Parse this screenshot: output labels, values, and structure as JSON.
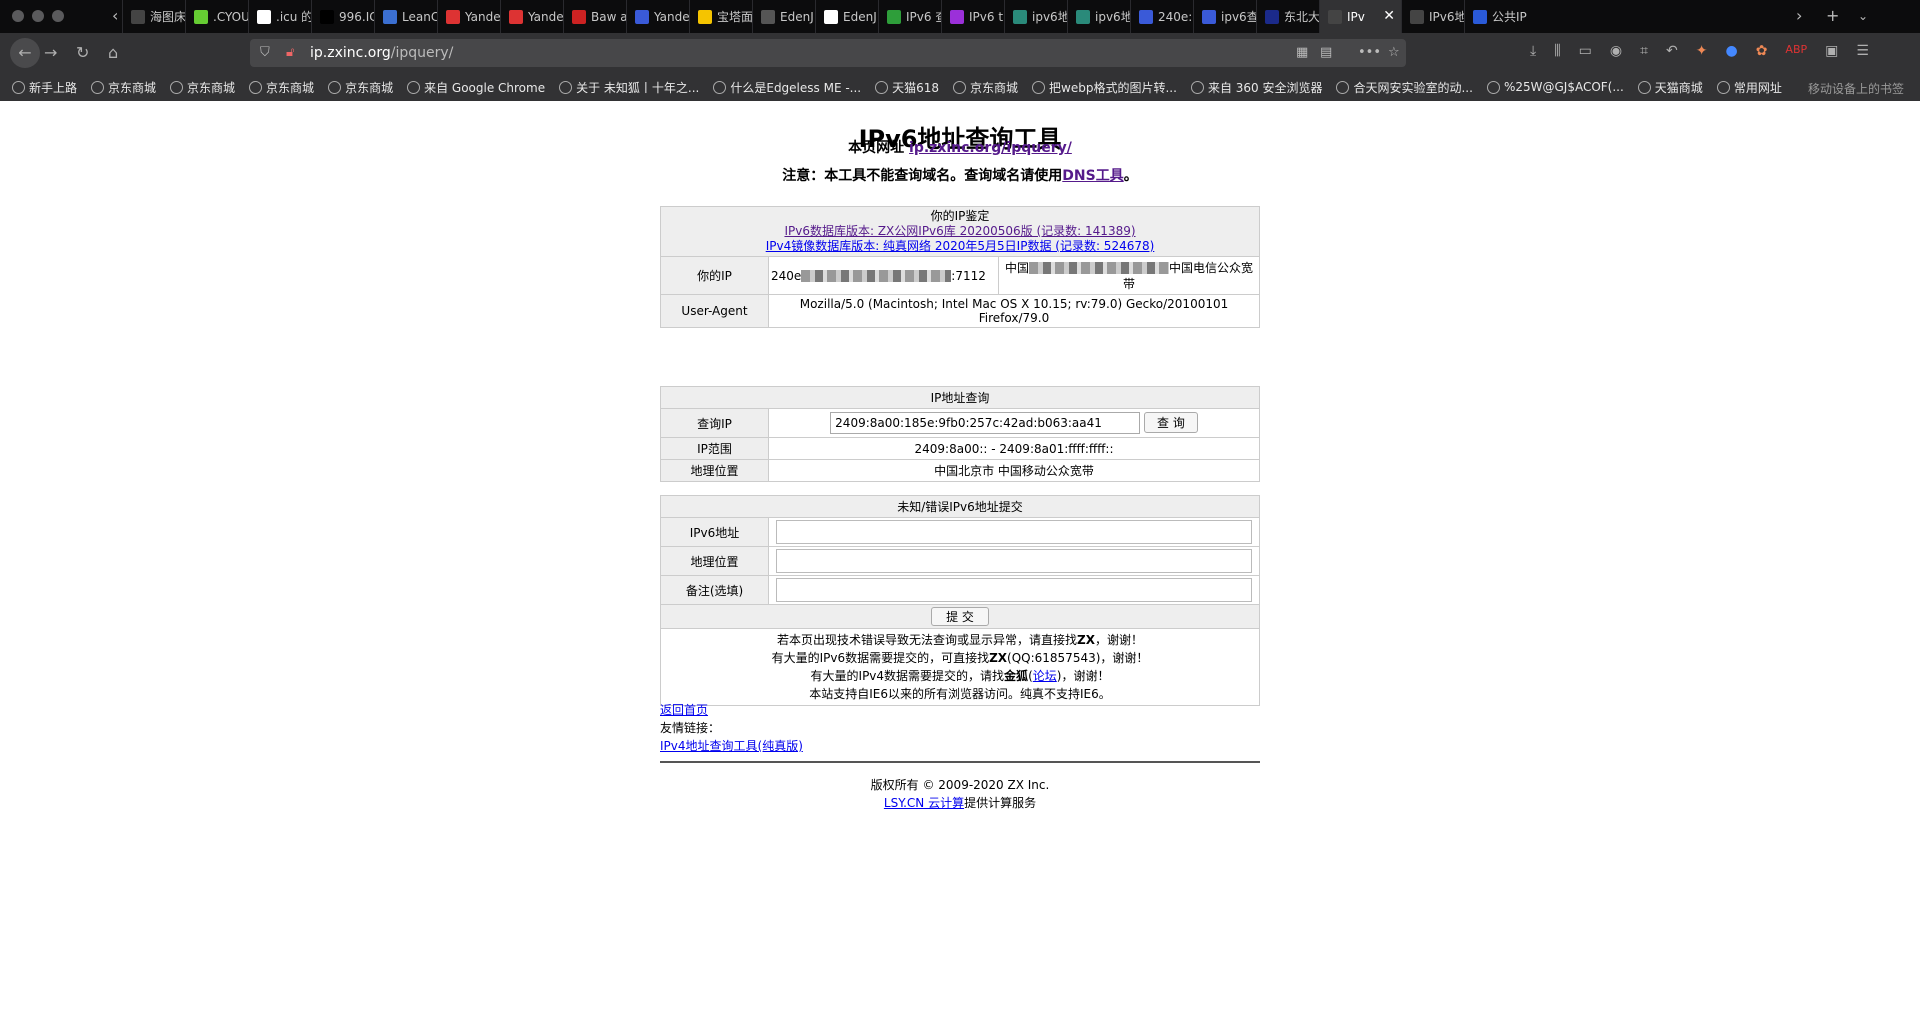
{
  "browser": {
    "tabs": [
      {
        "label": "海图床",
        "color": "#444"
      },
      {
        "label": ".CYOU",
        "color": "#6c3"
      },
      {
        "label": ".icu 的",
        "color": "#fff"
      },
      {
        "label": "996.ICU",
        "color": "#000"
      },
      {
        "label": "LeanC",
        "color": "#3b6fd1"
      },
      {
        "label": "Yande",
        "color": "#d33"
      },
      {
        "label": "Yande",
        "color": "#d33"
      },
      {
        "label": "Baw a",
        "color": "#c22"
      },
      {
        "label": "Yande",
        "color": "#3a5ad8"
      },
      {
        "label": "宝塔面",
        "color": "#f5c400"
      },
      {
        "label": "EdenJ",
        "color": "#555"
      },
      {
        "label": "EdenJ",
        "color": "#fff"
      },
      {
        "label": "IPv6 查",
        "color": "#2e9e3a"
      },
      {
        "label": "IPv6 t",
        "color": "#9b30d9"
      },
      {
        "label": "ipv6地",
        "color": "#2a8a7a"
      },
      {
        "label": "ipv6地",
        "color": "#2a8a7a"
      },
      {
        "label": "240e:",
        "color": "#3a5ad8"
      },
      {
        "label": "ipv6查",
        "color": "#3a5ad8"
      },
      {
        "label": "东北大",
        "color": "#1b2a8a"
      },
      {
        "label": "IPv",
        "color": "#444",
        "active": true
      },
      {
        "label": "IPv6地",
        "color": "#444"
      },
      {
        "label": "公共IP",
        "color": "#2a5ad8"
      }
    ],
    "url_host": "ip.zxinc.org",
    "url_path": "/ipquery/",
    "bookmarks": [
      "新手上路",
      "京东商城",
      "京东商城",
      "京东商城",
      "京东商城",
      "来自 Google Chrome",
      "关于 未知狐丨十年之...",
      "什么是Edgeless ME -...",
      "天猫618",
      "京东商城",
      "把webp格式的图片转...",
      "来自 360 安全浏览器",
      "合天网安实验室的动...",
      "%25W@GJ$ACOF(...",
      "天猫商城",
      "常用网址"
    ],
    "mobile_bookmarks": "移动设备上的书签"
  },
  "page": {
    "title": "IPv6地址查询工具",
    "page_url_label": "本页网址",
    "page_url": "ip.zxinc.org/ipquery/",
    "notice_prefix": "注意：本工具不能查询域名。查询域名请使用",
    "notice_link": "DNS工具",
    "notice_suffix": "。"
  },
  "identify": {
    "header": "你的IP鉴定",
    "ipv6_db": "IPv6数据库版本: ZX公网IPv6库 20200506版 (记录数: 141389)",
    "ipv4_db": "IPv4镜像数据库版本: 纯真网络 2020年5月5日IP数据 (记录数: 524678)",
    "your_ip_label": "你的IP",
    "your_ip_prefix": "240e",
    "your_ip_suffix": ":7112",
    "your_loc_prefix": "中国",
    "your_loc_suffix": "中国电信公众宽带",
    "ua_label": "User-Agent",
    "ua_value": "Mozilla/5.0 (Macintosh; Intel Mac OS X 10.15; rv:79.0) Gecko/20100101 Firefox/79.0"
  },
  "query": {
    "header": "IP地址查询",
    "ip_label": "查询IP",
    "ip_value": "2409:8a00:185e:9fb0:257c:42ad:b063:aa41",
    "button": "查 询",
    "range_label": "IP范围",
    "range_value": "2409:8a00:: - 2409:8a01:ffff:ffff::",
    "geo_label": "地理位置",
    "geo_value": "中国北京市 中国移动公众宽带"
  },
  "submit": {
    "header": "未知/错误IPv6地址提交",
    "ipv6_label": "IPv6地址",
    "geo_label": "地理位置",
    "note_label": "备注(选填)",
    "button": "提 交",
    "msg1_a": "若本页出现技术错误导致无法查询或显示异常，请直接找",
    "msg1_b": "ZX",
    "msg1_c": "，谢谢！",
    "msg2_a": "有大量的IPv6数据需要提交的，可直接找",
    "msg2_b": "ZX",
    "msg2_c": "(QQ:61857543)，谢谢！",
    "msg3_a": "有大量的IPv4数据需要提交的，请找",
    "msg3_b": "金狐",
    "msg3_c": "(",
    "msg3_link": "论坛",
    "msg3_d": ")，谢谢！",
    "msg4": "本站支持自IE6以来的所有浏览器访问。纯真不支持IE6。"
  },
  "footer": {
    "back_home": "返回首页",
    "friends": "友情链接：",
    "ipv4_tool": "IPv4地址查询工具(纯真版)",
    "copyright": "版权所有 © 2009-2020 ZX Inc.",
    "lsy_link": "LSY.CN 云计算",
    "lsy_suffix": "提供计算服务"
  }
}
